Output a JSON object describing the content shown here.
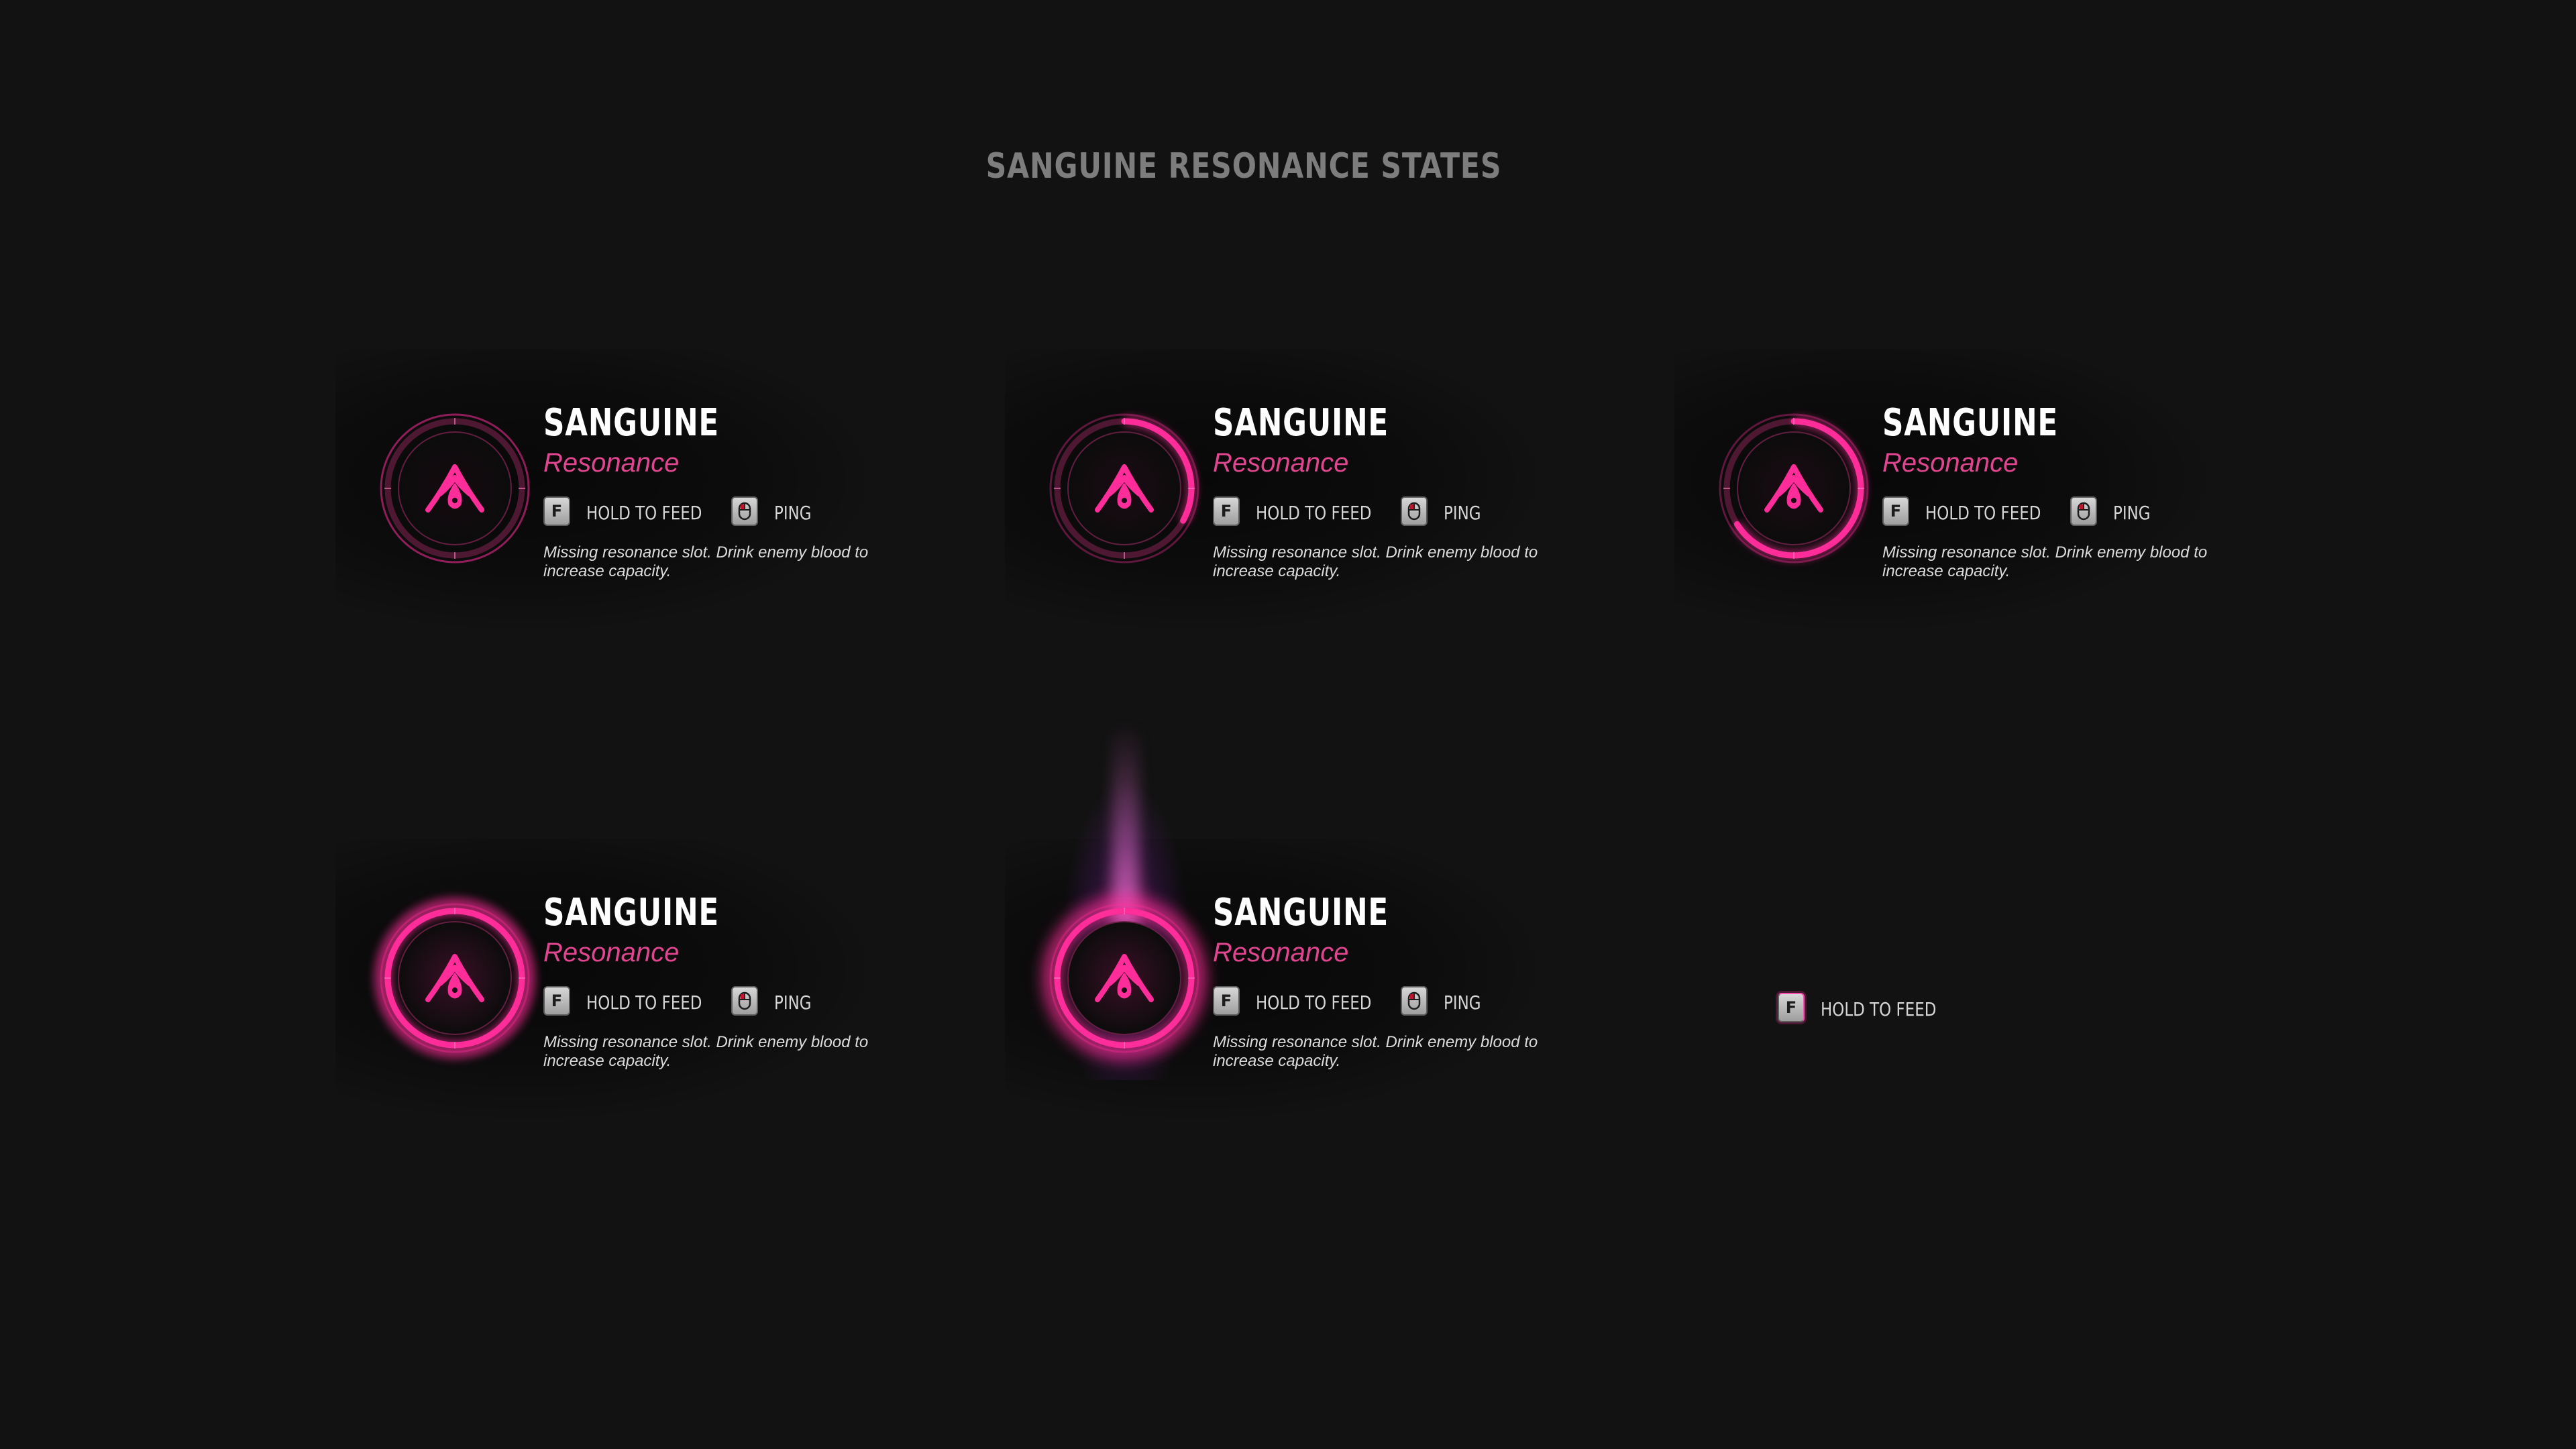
{
  "page": {
    "title": "SANGUINE RESONANCE STATES"
  },
  "colors": {
    "background": "#121212",
    "accent": "#ff2d9a",
    "subtitle": "#e0468f",
    "title_text": "#ffffff",
    "heading": "#7d7d7d"
  },
  "cards": [
    {
      "title": "SANGUINE",
      "subtitle": "Resonance",
      "state": "empty",
      "ring_fill": 0,
      "action_feed": {
        "key": "F",
        "label": "HOLD TO FEED"
      },
      "action_ping": {
        "icon": "mouse-icon",
        "label": "PING"
      },
      "description": "Missing resonance slot. Drink enemy blood to increase capacity."
    },
    {
      "title": "SANGUINE",
      "subtitle": "Resonance",
      "state": "filling",
      "ring_fill": 0.33,
      "action_feed": {
        "key": "F",
        "label": "HOLD TO FEED"
      },
      "action_ping": {
        "icon": "mouse-icon",
        "label": "PING"
      },
      "description": "Missing resonance slot. Drink enemy blood to increase capacity."
    },
    {
      "title": "SANGUINE",
      "subtitle": "Resonance",
      "state": "filling",
      "ring_fill": 0.66,
      "action_feed": {
        "key": "F",
        "label": "HOLD TO FEED"
      },
      "action_ping": {
        "icon": "mouse-icon",
        "label": "PING"
      },
      "description": "Missing resonance slot. Drink enemy blood to increase capacity."
    },
    {
      "title": "SANGUINE",
      "subtitle": "Resonance",
      "state": "full",
      "ring_fill": 1,
      "action_feed": {
        "key": "F",
        "label": "HOLD TO FEED"
      },
      "action_ping": {
        "icon": "mouse-icon",
        "label": "PING"
      },
      "description": "Missing resonance slot. Drink enemy blood to increase capacity."
    },
    {
      "title": "SANGUINE",
      "subtitle": "Resonance",
      "state": "activated",
      "ring_fill": 1,
      "action_feed": {
        "key": "F",
        "label": "HOLD TO FEED"
      },
      "action_ping": {
        "icon": "mouse-icon",
        "label": "PING"
      },
      "description": "Missing resonance slot. Drink enemy blood to increase capacity."
    }
  ],
  "standalone_prompt": {
    "key": "F",
    "label": "HOLD TO FEED"
  }
}
